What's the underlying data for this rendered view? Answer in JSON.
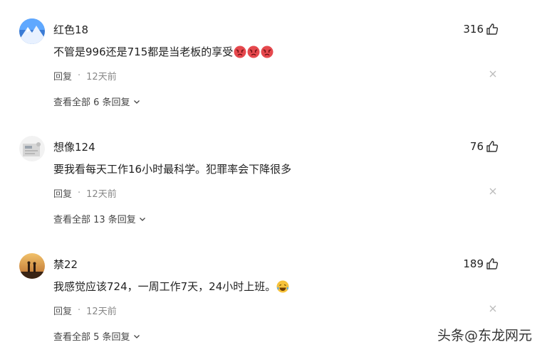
{
  "comments": [
    {
      "username": "红色18",
      "likes": "316",
      "text": "不管是996还是715都是当老板的享受",
      "emoji": [
        "angry-face-icon",
        "angry-face-icon",
        "angry-face-icon"
      ],
      "reply_label": "回复",
      "separator": "·",
      "time": "12天前",
      "view_all": "查看全部 6 条回复"
    },
    {
      "username": "想像124",
      "likes": "76",
      "text": "要我看每天工作16小时最科学。犯罪率会下降很多",
      "emoji": [],
      "reply_label": "回复",
      "separator": "·",
      "time": "12天前",
      "view_all": "查看全部 13 条回复"
    },
    {
      "username": "禁22",
      "likes": "189",
      "text": "我感觉应该724，一周工作7天，24小时上班。",
      "emoji": [
        "laugh-cry-face-icon"
      ],
      "reply_label": "回复",
      "separator": "·",
      "time": "12天前",
      "view_all": "查看全部 5 条回复"
    }
  ],
  "watermark": "头条@东龙网元",
  "colors": {
    "text": "#222222",
    "muted": "#888888",
    "emoji_angry": "#e5484d"
  }
}
